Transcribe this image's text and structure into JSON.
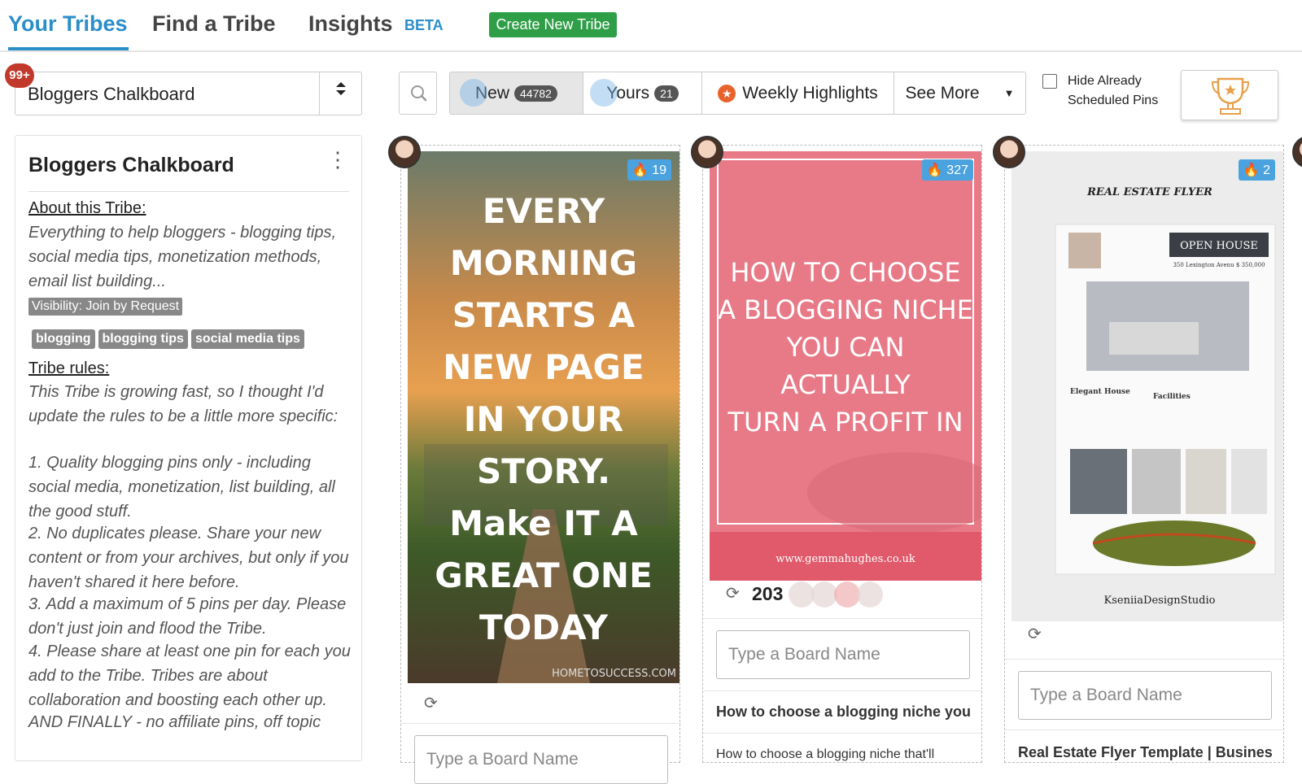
{
  "nav": {
    "tabs": [
      {
        "label": "Your Tribes"
      },
      {
        "label": "Find a Tribe"
      },
      {
        "label": "Insights"
      }
    ],
    "beta_label": "BETA",
    "create_label": "Create New Tribe",
    "active_color": "#2b8ec9",
    "create_color": "#2e9e47"
  },
  "tribe_select": {
    "value": "Bloggers Chalkboard",
    "notification_count": "99+"
  },
  "filters": {
    "new": {
      "label": "New",
      "count": "44782"
    },
    "yours": {
      "label": "Yours",
      "count": "21"
    },
    "weekly": {
      "label": "Weekly Highlights"
    },
    "more": {
      "label": "See More"
    },
    "hide_scheduled": "Hide Already Scheduled Pins"
  },
  "tribe_info": {
    "title": "Bloggers Chalkboard",
    "about_title": "About this Tribe:",
    "about_text": "Everything to help bloggers - blogging tips, social media tips, monetization methods, email list building...",
    "visibility": "Visibility: Join by Request",
    "tags": [
      "blogging",
      "blogging tips",
      "social media tips"
    ],
    "rules_title": "Tribe rules:",
    "rules_text": "This Tribe is growing fast, so I thought I'd update the rules to be a little more specific:",
    "rule_1": "1. Quality blogging pins only - including social media, monetization, list building, all the good stuff.",
    "rule_2": "2. No duplicates please. Share your new content or from your archives, but only if you haven't shared it here before.",
    "rule_3": "3. Add a maximum of 5 pins per day. Please don't just join and flood the Tribe.",
    "rule_4": "4. Please share at least one pin for each you add to the Tribe. Tribes are about collaboration and boosting each other up.",
    "rule_final": "AND FINALLY - no affiliate pins, off topic"
  },
  "pins": [
    {
      "fire_count": "19",
      "image_text": [
        "EVERY",
        "MORNING",
        "STARTS A",
        "NEW PAGE",
        "IN YOUR",
        "STORY.",
        "Make IT A",
        "GREAT ONE",
        "TODAY"
      ],
      "watermark": "HOMETOSUCCESS.COM",
      "board_placeholder": "Type a Board Name"
    },
    {
      "fire_count": "327",
      "image_text": [
        "HOW TO CHOOSE",
        "A BLOGGING NICHE",
        "YOU CAN",
        "ACTUALLY",
        "TURN A PROFIT IN"
      ],
      "url": "www.gemmahughes.co.uk",
      "repins": "203",
      "board_placeholder": "Type a Board Name",
      "title": "How to choose a blogging niche you",
      "description": "How to choose a blogging niche that'll"
    },
    {
      "fire_count": "2",
      "flyer_title": "REAL ESTATE FLYER",
      "open_house": "OPEN HOUSE",
      "address": "350 Lexington Avenu $ 350,000",
      "elegant": "Elegant House",
      "facilities": "Facilities",
      "studio": "KseniiaDesignStudio",
      "board_placeholder": "Type a Board Name",
      "title": "Real Estate Flyer Template | Busines"
    }
  ]
}
